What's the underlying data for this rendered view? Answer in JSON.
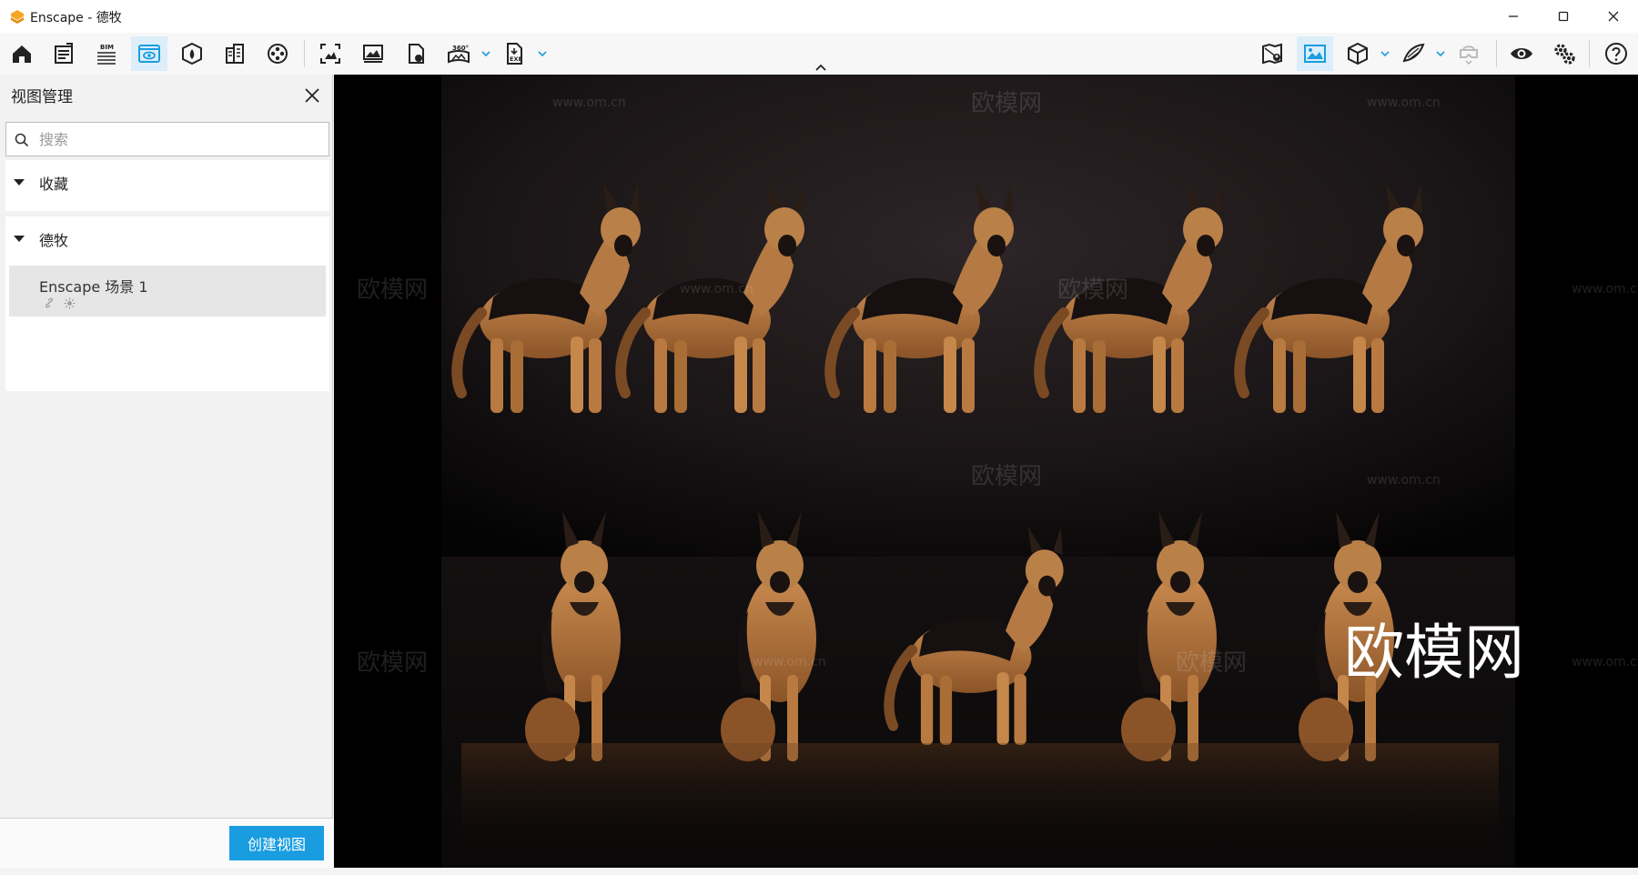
{
  "window": {
    "title": "Enscape - 德牧",
    "logo_color": "#f5a623"
  },
  "toolbar": {
    "left_icons": [
      "home-icon",
      "document-icon",
      "bim-icon",
      "view-management-icon",
      "atmosphere-icon",
      "asset-library-icon",
      "video-editor-icon",
      "screenshot-icon",
      "image-icon",
      "export-icon",
      "panorama-360-icon",
      "exe-export-icon"
    ],
    "bim_label": "BIM",
    "pano_label": "360°",
    "exe_label": "EXE",
    "right_icons": [
      "map-pin-icon",
      "image-view-icon",
      "cube-icon",
      "wing-icon",
      "vr-headset-icon",
      "eye-icon",
      "settings-icon",
      "help-icon"
    ],
    "accent": "#1a9de0"
  },
  "panel": {
    "title": "视图管理",
    "search_placeholder": "搜索",
    "groups": [
      {
        "label": "收藏"
      },
      {
        "label": "德牧"
      }
    ],
    "views": [
      {
        "name": "Enscape 场景 1"
      }
    ],
    "create_button": "创建视图"
  },
  "viewport": {
    "watermark_brand": "欧模网",
    "watermark_url": "www.om.cn",
    "big_watermark": "欧模网"
  }
}
